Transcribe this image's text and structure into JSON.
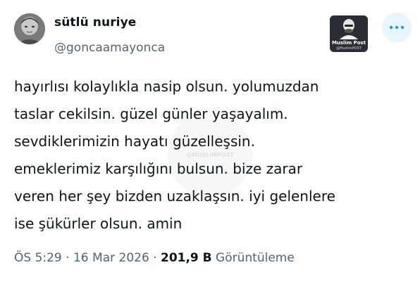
{
  "author": {
    "name": "sütlü nuriye",
    "handle": "@goncaamayonca"
  },
  "brand_logo": {
    "name": "Muslim Post",
    "handle": "@MuslimPOST"
  },
  "watermark_text": "@MUSLIMPOST",
  "tweet": {
    "lines": [
      "hayırlısı kolaylıkla nasip olsun. yolumuzdan",
      "taslar cekilsin. güzel günler yaşayalım.",
      "sevdiklerimizin hayatı güzelleşsin.",
      "emeklerimiz karşılığını bulsun. bize zarar",
      "veren her şey bizden uzaklaşsın. iyi gelenlere",
      "ise şükürler olsun. amin"
    ]
  },
  "meta": {
    "time": "ÖS 5:29",
    "separator": "·",
    "date": "16 Mar 2026",
    "views_count": "201,9 B",
    "views_label": "Görüntüleme"
  },
  "colors": {
    "text": "#0f1419",
    "muted": "#536471",
    "more_button_bg": "#e8f5fd",
    "more_icon": "#1d9bf0"
  },
  "icons": {
    "more": "more-horizontal-icon"
  }
}
